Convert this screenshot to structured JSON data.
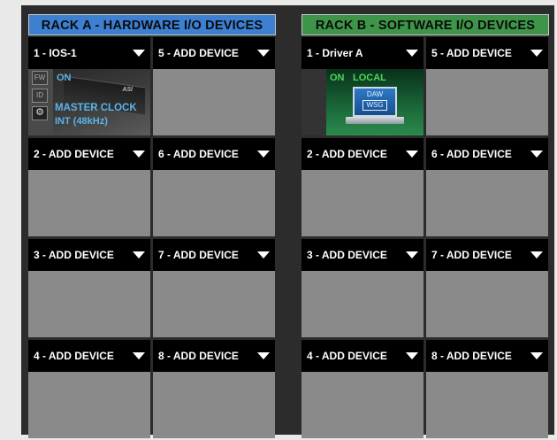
{
  "rack_a": {
    "title": "RACK A - HARDWARE I/O DEVICES",
    "slots": [
      {
        "label": "1 - IOS-1"
      },
      {
        "label": "5 - ADD DEVICE"
      },
      {
        "label": "2 - ADD DEVICE"
      },
      {
        "label": "6 - ADD DEVICE"
      },
      {
        "label": "3 - ADD DEVICE"
      },
      {
        "label": "7 - ADD DEVICE"
      },
      {
        "label": "4 - ADD DEVICE"
      },
      {
        "label": "8 - ADD DEVICE"
      }
    ],
    "device1": {
      "fw_label": "FW",
      "id_label": "ID",
      "status": "ON",
      "clock_label": "MASTER CLOCK",
      "clock_value": "INT (48kHz)",
      "brand": "ASI"
    }
  },
  "rack_b": {
    "title": "RACK B - SOFTWARE I/O DEVICES",
    "slots": [
      {
        "label": "1 - Driver A"
      },
      {
        "label": "5 - ADD DEVICE"
      },
      {
        "label": "2 - ADD DEVICE"
      },
      {
        "label": "6 - ADD DEVICE"
      },
      {
        "label": "3 - ADD DEVICE"
      },
      {
        "label": "7 - ADD DEVICE"
      },
      {
        "label": "4 - ADD DEVICE"
      },
      {
        "label": "8 - ADD DEVICE"
      }
    ],
    "device1": {
      "status": "ON",
      "location": "LOCAL",
      "screen_line1": "DAW",
      "screen_line2": "WSG"
    }
  },
  "colors": {
    "rack_a_header": "#3d7fd1",
    "rack_b_header": "#3e9448",
    "status_blue": "#5ab4e8",
    "status_green": "#4fd65a"
  }
}
